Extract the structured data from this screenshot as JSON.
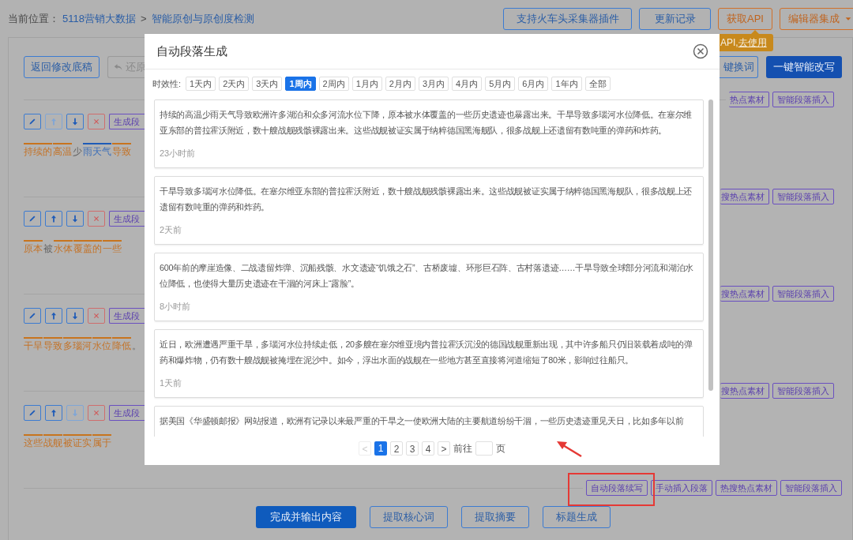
{
  "breadcrumb": {
    "label": "当前位置：",
    "links": [
      "5118营销大数据",
      "智能原创与原创度检测"
    ],
    "separator": ">"
  },
  "header_buttons": [
    {
      "label": "支持火车头采集器插件",
      "kind": "blue"
    },
    {
      "label": "更新记录",
      "kind": "blue"
    },
    {
      "label": "获取API",
      "kind": "orange"
    },
    {
      "label": "编辑器集成",
      "kind": "orange-dropdown"
    }
  ],
  "tooltip": {
    "text": "API,",
    "link": "去使用"
  },
  "toolbar": {
    "left": [
      {
        "label": "返回修改底稿",
        "kind": "outline"
      },
      {
        "label": "还原",
        "kind": "undo"
      }
    ],
    "right": [
      {
        "label": "键换词",
        "kind": "outline"
      },
      {
        "label": "一键智能改写",
        "kind": "primary"
      }
    ]
  },
  "paragraphs": [
    {
      "insert_buttons": [
        "热点素材",
        "智能段落插入"
      ],
      "tools": [
        {
          "kind": "edit",
          "disabled": false
        },
        {
          "kind": "up",
          "disabled": true
        },
        {
          "kind": "down",
          "disabled": false
        },
        {
          "kind": "delete",
          "disabled": false
        }
      ],
      "generate_label": "生成段",
      "segments": [
        {
          "text": "持续的",
          "kind": "orange"
        },
        {
          "text": "高温",
          "kind": "orange"
        },
        {
          "text": "少",
          "kind": "plain"
        },
        {
          "text": "雨天气",
          "kind": "blue"
        },
        {
          "text": "导致",
          "kind": "orange"
        }
      ]
    },
    {
      "insert_buttons": [
        "搜热点素材",
        "智能段落插入"
      ],
      "tools": [
        {
          "kind": "edit",
          "disabled": false
        },
        {
          "kind": "up",
          "disabled": false
        },
        {
          "kind": "down",
          "disabled": false
        },
        {
          "kind": "delete",
          "disabled": false
        }
      ],
      "generate_label": "生成段",
      "segments": [
        {
          "text": "原本",
          "kind": "orange"
        },
        {
          "text": "被",
          "kind": "plain"
        },
        {
          "text": "水体",
          "kind": "orange"
        },
        {
          "text": "覆盖的",
          "kind": "orange"
        },
        {
          "text": "一些",
          "kind": "orange"
        }
      ]
    },
    {
      "insert_buttons": [
        "搜热点素材",
        "智能段落插入"
      ],
      "tools": [
        {
          "kind": "edit",
          "disabled": false
        },
        {
          "kind": "up",
          "disabled": false
        },
        {
          "kind": "down",
          "disabled": false
        },
        {
          "kind": "delete",
          "disabled": false
        }
      ],
      "generate_label": "生成段",
      "segments": [
        {
          "text": "干旱",
          "kind": "orange"
        },
        {
          "text": "导致",
          "kind": "orange"
        },
        {
          "text": "多瑙河",
          "kind": "orange"
        },
        {
          "text": "水位",
          "kind": "orange"
        },
        {
          "text": "降低",
          "kind": "orange"
        },
        {
          "text": "。",
          "kind": "plain"
        }
      ]
    },
    {
      "insert_buttons": [
        "搜热点素材",
        "智能段落插入"
      ],
      "tools": [
        {
          "kind": "edit",
          "disabled": false
        },
        {
          "kind": "up",
          "disabled": false
        },
        {
          "kind": "down",
          "disabled": true
        },
        {
          "kind": "delete",
          "disabled": false
        }
      ],
      "generate_label": "生成段",
      "segments": [
        {
          "text": "这些",
          "kind": "orange"
        },
        {
          "text": "战舰",
          "kind": "orange"
        },
        {
          "text": "被证实",
          "kind": "orange"
        },
        {
          "text": "属于",
          "kind": "orange"
        }
      ]
    }
  ],
  "insert_bar": {
    "buttons": [
      {
        "label": "自动段落续写",
        "highlighted": true
      },
      {
        "label": "手动插入段落",
        "highlighted": false
      },
      {
        "label": "热搜热点素材",
        "highlighted": false
      },
      {
        "label": "智能段落插入",
        "highlighted": false
      }
    ]
  },
  "bottom_buttons": [
    {
      "label": "完成并输出内容",
      "kind": "primary"
    },
    {
      "label": "提取核心词",
      "kind": "outline"
    },
    {
      "label": "提取摘要",
      "kind": "outline"
    },
    {
      "label": "标题生成",
      "kind": "outline"
    }
  ],
  "modal": {
    "title": "自动段落生成",
    "filter_label": "时效性:",
    "filters": [
      {
        "label": "1天内",
        "selected": false
      },
      {
        "label": "2天内",
        "selected": false
      },
      {
        "label": "3天内",
        "selected": false
      },
      {
        "label": "1周内",
        "selected": true
      },
      {
        "label": "2周内",
        "selected": false
      },
      {
        "label": "1月内",
        "selected": false
      },
      {
        "label": "2月内",
        "selected": false
      },
      {
        "label": "3月内",
        "selected": false
      },
      {
        "label": "4月内",
        "selected": false
      },
      {
        "label": "5月内",
        "selected": false
      },
      {
        "label": "6月内",
        "selected": false
      },
      {
        "label": "1年内",
        "selected": false
      },
      {
        "label": "全部",
        "selected": false
      }
    ],
    "results": [
      {
        "text": "持续的高温少雨天气导致欧洲许多湖泊和众多河流水位下降，原本被水体覆盖的一些历史遗迹也暴露出来。干旱导致多瑙河水位降低。在塞尔维亚东部的普拉霍沃附近，数十艘战舰残骸裸露出来。这些战舰被证实属于纳粹德国黑海舰队，很多战舰上还遗留有数吨重的弹药和炸药。",
        "time": "23小时前"
      },
      {
        "text": "干旱导致多瑙河水位降低。在塞尔维亚东部的普拉霍沃附近，数十艘战舰残骸裸露出来。这些战舰被证实属于纳粹德国黑海舰队，很多战舰上还遗留有数吨重的弹药和炸药。",
        "time": "2天前"
      },
      {
        "text": "600年前的摩崖造像、二战遗留炸弹、沉船残骸、水文遗迹“饥饿之石”、古桥废墟、环形巨石阵、古村落遗迹……干旱导致全球部分河流和湖泊水位降低，也使得大量历史遗迹在干涸的河床上“露脸”。",
        "time": "8小时前"
      },
      {
        "text": "近日，欧洲遭遇严重干旱，多瑙河水位持续走低，20多艘在塞尔维亚境内普拉霍沃沉没的德国战舰重新出现，其中许多船只仍旧装载着成吨的弹药和爆炸物，仍有数十艘战舰被掩埋在泥沙中。如今，浮出水面的战舰在一些地方甚至直接将河道缩短了80米，影响过往船只。",
        "time": "1天前"
      },
      {
        "text": "据美国《华盛顿邮报》网站报道，欧洲有记录以来最严重的干旱之一使欧洲大陆的主要航道纷纷干涸，一些历史遗迹重见天日，比如多年以前"
      }
    ],
    "pagination": {
      "prev": {
        "label": "<",
        "disabled": true
      },
      "pages": [
        {
          "label": "1",
          "selected": true
        },
        {
          "label": "2",
          "selected": false
        },
        {
          "label": "3",
          "selected": false
        },
        {
          "label": "4",
          "selected": false
        }
      ],
      "next": {
        "label": ">",
        "disabled": false
      },
      "goto_label": "前往",
      "page_suffix": "页"
    }
  }
}
